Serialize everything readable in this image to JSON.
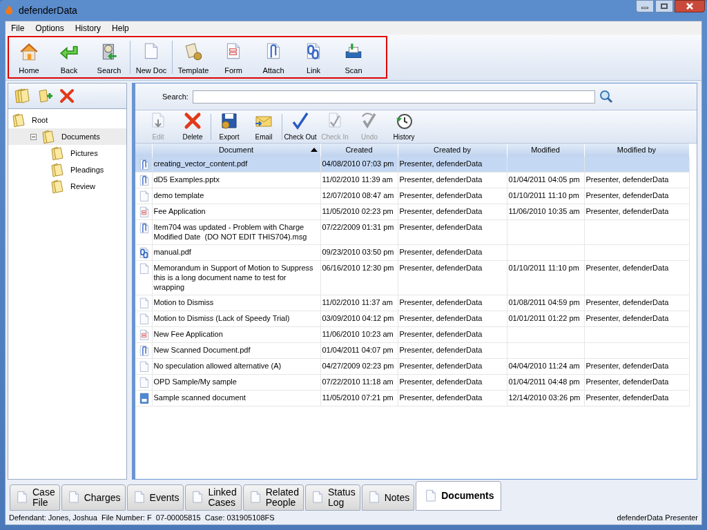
{
  "window": {
    "title": "defenderData"
  },
  "menu": [
    "File",
    "Options",
    "History",
    "Help"
  ],
  "toolbar": [
    {
      "label": "Home"
    },
    {
      "label": "Back"
    },
    {
      "label": "Search"
    },
    {
      "label": "New Doc"
    },
    {
      "label": "Template"
    },
    {
      "label": "Form"
    },
    {
      "label": "Attach"
    },
    {
      "label": "Link"
    },
    {
      "label": "Scan"
    }
  ],
  "folder_tree": {
    "items": [
      {
        "label": "Root",
        "selected": false,
        "children": [
          {
            "label": "Documents",
            "selected": true,
            "expanded": true,
            "children": [
              {
                "label": "Pictures",
                "selected": false
              },
              {
                "label": "Pleadings",
                "selected": false
              },
              {
                "label": "Review",
                "selected": false
              }
            ]
          }
        ]
      }
    ]
  },
  "search": {
    "label": "Search:"
  },
  "doc_toolbar": [
    {
      "label": "Edit",
      "disabled": true
    },
    {
      "label": "Delete",
      "disabled": false
    },
    {
      "label": "Export",
      "disabled": false
    },
    {
      "label": "Email",
      "disabled": false
    },
    {
      "label": "Check Out",
      "disabled": false
    },
    {
      "label": "Check In",
      "disabled": true
    },
    {
      "label": "Undo",
      "disabled": true
    },
    {
      "label": "History",
      "disabled": false
    }
  ],
  "table": {
    "columns": [
      "Document",
      "Created",
      "Created by",
      "Modified",
      "Modified by"
    ],
    "rows": [
      {
        "kind": "attachment",
        "selected": true,
        "cells": [
          "creating_vector_content.pdf",
          "04/08/2010 07:03 pm",
          "Presenter, defenderData",
          "",
          ""
        ]
      },
      {
        "kind": "attachment",
        "selected": false,
        "cells": [
          "dD5 Examples.pptx",
          "11/02/2010 11:39 am",
          "Presenter, defenderData",
          "01/04/2011 04:05 pm",
          "Presenter, defenderData"
        ]
      },
      {
        "kind": "document",
        "selected": false,
        "cells": [
          "demo template",
          "12/07/2010 08:47 am",
          "Presenter, defenderData",
          "01/10/2011 11:10 pm",
          "Presenter, defenderData"
        ]
      },
      {
        "kind": "form",
        "selected": false,
        "cells": [
          "Fee Application",
          "11/05/2010 02:23 pm",
          "Presenter, defenderData",
          "11/06/2010 10:35 am",
          "Presenter, defenderData"
        ]
      },
      {
        "kind": "attachment",
        "selected": false,
        "cells": [
          "Item704 was updated - Problem with Charge Modified Date  (DO NOT EDIT THIS704).msg",
          "07/22/2009 01:31 pm",
          "Presenter, defenderData",
          "",
          ""
        ]
      },
      {
        "kind": "link",
        "selected": false,
        "cells": [
          "manual.pdf",
          "09/23/2010 03:50 pm",
          "Presenter, defenderData",
          "",
          ""
        ]
      },
      {
        "kind": "document",
        "selected": false,
        "cells": [
          "Memorandum in Support of Motion to Suppress this is a long document name to test for wrapping",
          "06/16/2010 12:30 pm",
          "Presenter, defenderData",
          "01/10/2011 11:10 pm",
          "Presenter, defenderData"
        ]
      },
      {
        "kind": "document",
        "selected": false,
        "cells": [
          "Motion to Dismiss",
          "11/02/2010 11:37 am",
          "Presenter, defenderData",
          "01/08/2011 04:59 pm",
          "Presenter, defenderData"
        ]
      },
      {
        "kind": "document",
        "selected": false,
        "cells": [
          "Motion to Dismiss (Lack of Speedy Trial)",
          "03/09/2010 04:12 pm",
          "Presenter, defenderData",
          "01/01/2011 01:22 pm",
          "Presenter, defenderData"
        ]
      },
      {
        "kind": "form",
        "selected": false,
        "cells": [
          "New Fee Application",
          "11/06/2010 10:23 am",
          "Presenter, defenderData",
          "",
          ""
        ]
      },
      {
        "kind": "attachment",
        "selected": false,
        "cells": [
          "New Scanned Document.pdf",
          "01/04/2011 04:07 pm",
          "Presenter, defenderData",
          "",
          ""
        ]
      },
      {
        "kind": "document",
        "selected": false,
        "cells": [
          "No speculation allowed alternative (A)",
          "04/27/2009 02:23 pm",
          "Presenter, defenderData",
          "04/04/2010 11:24 am",
          "Presenter, defenderData"
        ]
      },
      {
        "kind": "document",
        "selected": false,
        "cells": [
          "OPD Sample/My sample",
          "07/22/2010 11:18 am",
          "Presenter, defenderData",
          "01/04/2011 04:48 pm",
          "Presenter, defenderData"
        ]
      },
      {
        "kind": "scan",
        "selected": false,
        "cells": [
          "Sample scanned document",
          "11/05/2010 07:21 pm",
          "Presenter, defenderData",
          "12/14/2010 03:26 pm",
          "Presenter, defenderData"
        ]
      }
    ]
  },
  "tabs": [
    {
      "label": "Case File",
      "selected": false
    },
    {
      "label": "Charges",
      "selected": false
    },
    {
      "label": "Events",
      "selected": false
    },
    {
      "label": "Linked Cases",
      "selected": false
    },
    {
      "label": "Related People",
      "selected": false
    },
    {
      "label": "Status Log",
      "selected": false
    },
    {
      "label": "Notes",
      "selected": false
    },
    {
      "label": "Documents",
      "selected": true
    }
  ],
  "status_bar": {
    "left": "Defendant: Jones, Joshua  File Number: F  07-00005815  Case: 031905108FS",
    "right": "defenderData Presenter"
  }
}
